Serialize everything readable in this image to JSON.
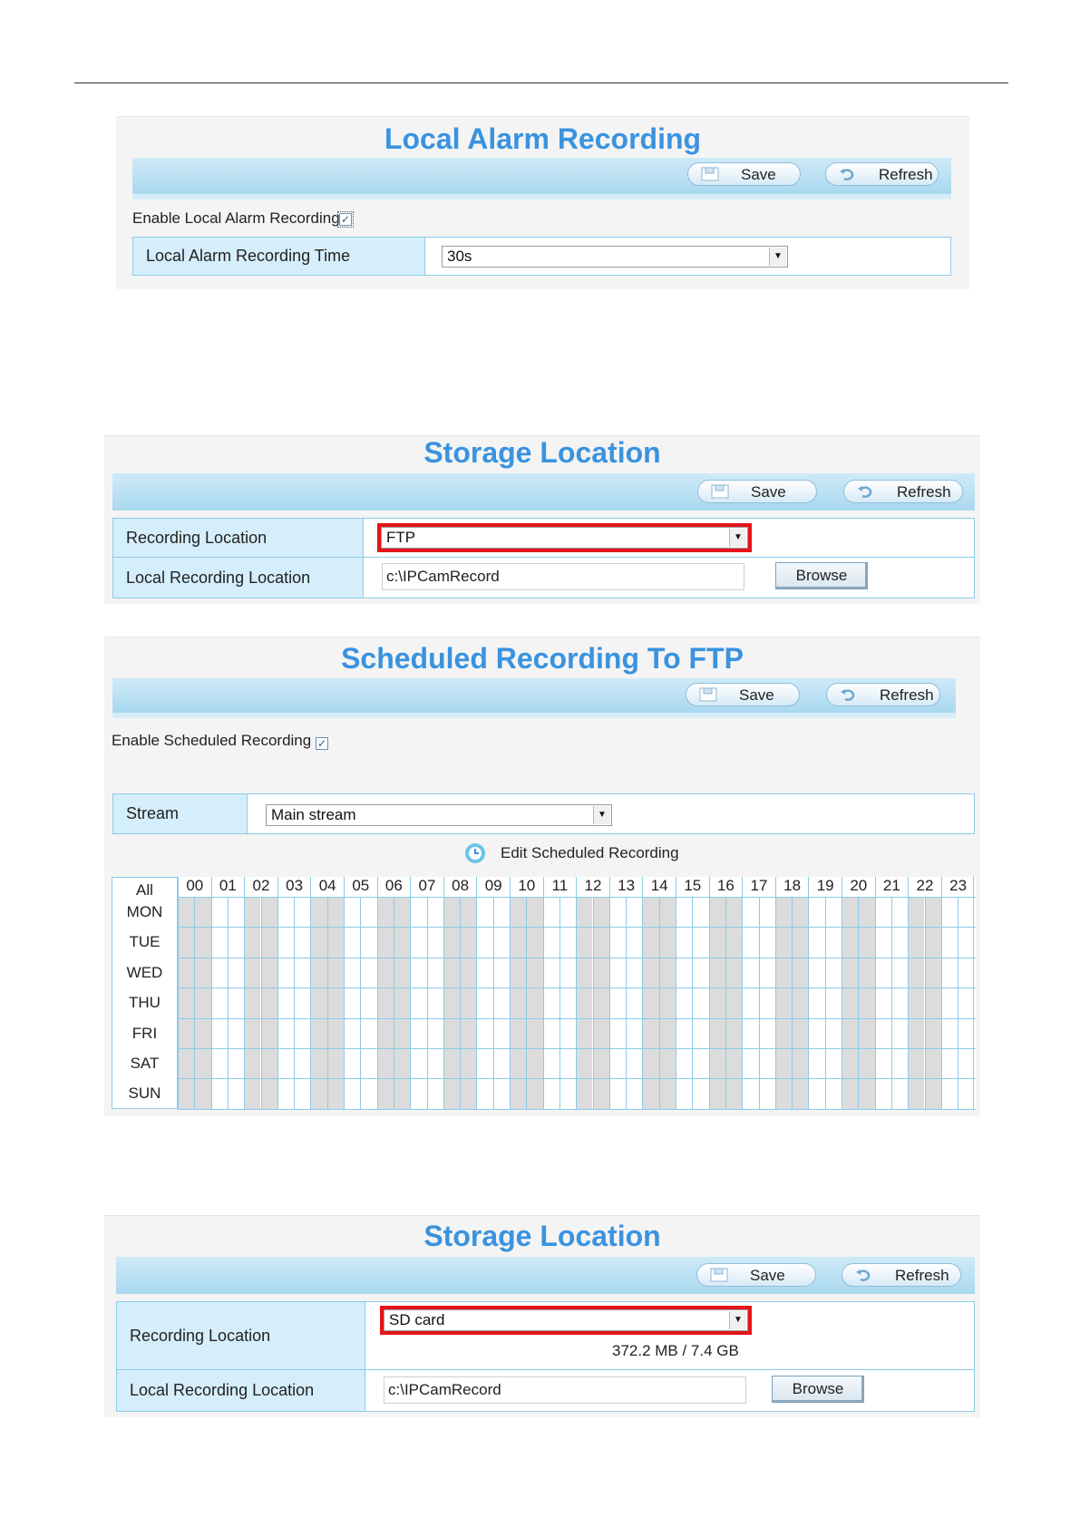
{
  "alarm_panel": {
    "title": "Local Alarm Recording",
    "save_label": "Save",
    "refresh_label": "Refresh",
    "enable_label": "Enable Local Alarm Recording",
    "enable_checked": true,
    "time_label": "Local Alarm Recording Time",
    "time_value": "30s"
  },
  "storage_ftp": {
    "title": "Storage Location",
    "save_label": "Save",
    "refresh_label": "Refresh",
    "location_label": "Recording Location",
    "location_value": "FTP",
    "local_location_label": "Local Recording Location",
    "local_location_value": "c:\\IPCamRecord",
    "browse_label": "Browse"
  },
  "schedule_panel": {
    "title": "Scheduled Recording To FTP",
    "save_label": "Save",
    "refresh_label": "Refresh",
    "enable_label": "Enable Scheduled Recording",
    "enable_checked": true,
    "stream_label": "Stream",
    "stream_value": "Main stream",
    "edit_label": "Edit Scheduled Recording",
    "all_label": "All",
    "days": [
      "MON",
      "TUE",
      "WED",
      "THU",
      "FRI",
      "SAT",
      "SUN"
    ],
    "hours": [
      "00",
      "01",
      "02",
      "03",
      "04",
      "05",
      "06",
      "07",
      "08",
      "09",
      "10",
      "11",
      "12",
      "13",
      "14",
      "15",
      "16",
      "17",
      "18",
      "19",
      "20",
      "21",
      "22",
      "23"
    ]
  },
  "storage_sd": {
    "title": "Storage Location",
    "save_label": "Save",
    "refresh_label": "Refresh",
    "location_label": "Recording Location",
    "location_value": "SD card",
    "capacity": "372.2 MB / 7.4 GB",
    "local_location_label": "Local Recording Location",
    "local_location_value": "c:\\IPCamRecord",
    "browse_label": "Browse"
  },
  "colors": {
    "title": "#3a93df",
    "highlight": "#e5141b",
    "border": "#8ccbe8",
    "label_bg": "#d5eefb"
  }
}
